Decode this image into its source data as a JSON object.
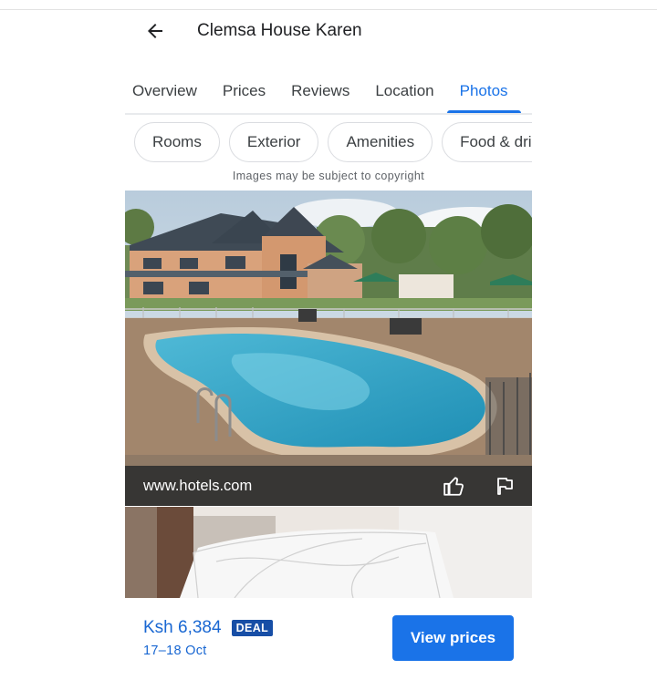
{
  "header": {
    "title": "Clemsa House Karen",
    "back_icon": "arrow-left-icon"
  },
  "tabs": [
    {
      "label": "Overview",
      "active": false
    },
    {
      "label": "Prices",
      "active": false
    },
    {
      "label": "Reviews",
      "active": false
    },
    {
      "label": "Location",
      "active": false
    },
    {
      "label": "Photos",
      "active": true
    }
  ],
  "chips": [
    "Rooms",
    "Exterior",
    "Amenities",
    "Food & drink"
  ],
  "copyright_notice": "Images may be subject to copyright",
  "photo": {
    "source": "www.hotels.com",
    "like_icon": "thumbs-up-icon",
    "report_icon": "flag-icon"
  },
  "booking": {
    "price": "Ksh 6,384",
    "badge": "DEAL",
    "dates": "17–18 Oct",
    "button_label": "View prices"
  },
  "colors": {
    "accent": "#1a73e8",
    "price": "#1967d2",
    "deal_badge": "#174ea6",
    "credit_bar": "#303030"
  }
}
